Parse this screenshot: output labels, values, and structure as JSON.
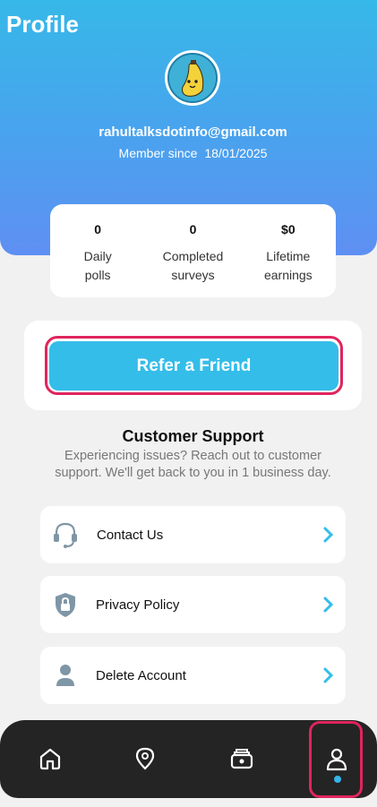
{
  "header": {
    "title": "Profile"
  },
  "profile": {
    "email": "rahultalksdotinfo@gmail.com",
    "member_label": "Member since",
    "member_date": "18/01/2025"
  },
  "stats": [
    {
      "value": "0",
      "label": "Daily polls"
    },
    {
      "value": "0",
      "label": "Completed surveys"
    },
    {
      "value": "$0",
      "label": "Lifetime earnings"
    }
  ],
  "refer": {
    "label": "Refer a Friend"
  },
  "support": {
    "title": "Customer Support",
    "description": "Experiencing issues? Reach out to customer support. We'll get back to you in 1 business day."
  },
  "menu": [
    {
      "label": "Contact Us",
      "icon": "headset-icon"
    },
    {
      "label": "Privacy Policy",
      "icon": "shield-lock-icon"
    },
    {
      "label": "Delete Account",
      "icon": "user-icon"
    }
  ],
  "nav": [
    {
      "icon": "home-icon"
    },
    {
      "icon": "location-pin-icon"
    },
    {
      "icon": "wallet-icon"
    },
    {
      "icon": "profile-icon",
      "active": true
    }
  ],
  "colors": {
    "accent": "#34bde9",
    "highlight": "#e0255e",
    "nav_bg": "#242424"
  }
}
